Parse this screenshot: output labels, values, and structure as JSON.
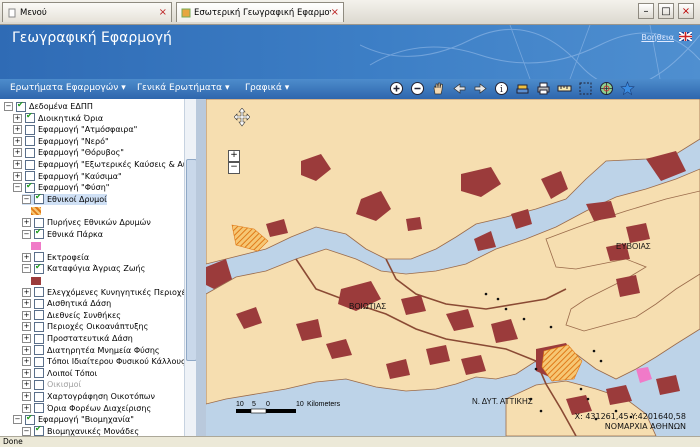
{
  "browser_tabs": [
    {
      "label": "Μενού",
      "active": false
    },
    {
      "label": "Εσωτερική Γεωγραφική Εφαρμογή",
      "active": true
    }
  ],
  "header": {
    "title": "Γεωγραφική Εφαρμογή",
    "help": "Βοήθεια"
  },
  "menus": [
    "Ερωτήματα Εφαρμογών",
    "Γενικά Ερωτήματα",
    "Γραφικά"
  ],
  "toolbar_icons": [
    "zoom-in-icon",
    "zoom-out-icon",
    "pan-hand-icon",
    "back-icon",
    "forward-icon",
    "identify-icon",
    "layers-icon",
    "print-icon",
    "measure-icon",
    "select-icon",
    "globe-icon",
    "star-icon"
  ],
  "layers": [
    {
      "label": "Δεδομένα ΕΔΠΠ",
      "checked": true,
      "indent": 0,
      "expander": "−"
    },
    {
      "label": "Διοικητικά Όρια",
      "checked": true,
      "indent": 1,
      "expander": "+"
    },
    {
      "label": "Εφαρμογή \"Ατμόσφαιρα\"",
      "checked": false,
      "indent": 1,
      "expander": "+"
    },
    {
      "label": "Εφαρμογή \"Νερό\"",
      "checked": false,
      "indent": 1,
      "expander": "+"
    },
    {
      "label": "Εφαρμογή \"Θόρυβος\"",
      "checked": false,
      "indent": 1,
      "expander": "+"
    },
    {
      "label": "Εφαρμογή \"Εξωτερικές Καύσεις & Αυτοκ",
      "checked": false,
      "indent": 1,
      "expander": "+"
    },
    {
      "label": "Εφαρμογή \"Καύσιμα\"",
      "checked": false,
      "indent": 1,
      "expander": "+"
    },
    {
      "label": "Εφαρμογή \"Φύση\"",
      "checked": true,
      "indent": 1,
      "expander": "−"
    },
    {
      "label": "Εθνικοί Δρυμοί",
      "checked": true,
      "indent": 2,
      "expander": "−",
      "selected": true
    },
    {
      "swatch": "orange-hatch",
      "indent": 3
    },
    {
      "label": "Πυρήνες Εθνικών Δρυμών",
      "checked": false,
      "indent": 2,
      "expander": "+"
    },
    {
      "label": "Εθνικά Πάρκα",
      "checked": true,
      "indent": 2,
      "expander": "−"
    },
    {
      "swatch": "pink",
      "indent": 3
    },
    {
      "label": "Εκτροφεία",
      "checked": false,
      "indent": 2,
      "expander": "+"
    },
    {
      "label": "Καταφύγια Άγριας Ζωής",
      "checked": true,
      "indent": 2,
      "expander": "−"
    },
    {
      "swatch": "brown",
      "indent": 3
    },
    {
      "label": "Ελεγχόμενες Κυνηγητικές Περιοχές",
      "checked": false,
      "indent": 2,
      "expander": "+"
    },
    {
      "label": "Αισθητικά Δάση",
      "checked": false,
      "indent": 2,
      "expander": "+"
    },
    {
      "label": "Διεθνείς Συνθήκες",
      "checked": false,
      "indent": 2,
      "expander": "+"
    },
    {
      "label": "Περιοχές Οικοανάπτυξης",
      "checked": false,
      "indent": 2,
      "expander": "+"
    },
    {
      "label": "Προστατευτικά Δάση",
      "checked": false,
      "indent": 2,
      "expander": "+"
    },
    {
      "label": "Διατηρητέα Μνημεία Φύσης",
      "checked": false,
      "indent": 2,
      "expander": "+"
    },
    {
      "label": "Τόποι Ιδιαίτερου Φυσικού Κάλλους",
      "checked": false,
      "indent": 2,
      "expander": "+"
    },
    {
      "label": "Λοιποί Τόποι",
      "checked": false,
      "indent": 2,
      "expander": "+"
    },
    {
      "label": "Οικισμοί",
      "checked": false,
      "indent": 2,
      "expander": "+",
      "greyed": true
    },
    {
      "label": "Χαρτογράφηση Οικοτόπων",
      "checked": false,
      "indent": 2,
      "expander": "+"
    },
    {
      "label": "Όρια Φορέων Διαχείρισης",
      "checked": false,
      "indent": 2,
      "expander": "+"
    },
    {
      "label": "Εφαρμογή \"Βιομηχανία\"",
      "checked": true,
      "indent": 1,
      "expander": "−"
    },
    {
      "label": "Βιομηχανικές Μονάδες",
      "checked": true,
      "indent": 2,
      "expander": "−"
    }
  ],
  "map": {
    "labels": [
      "ΕΥΒΟΙΑΣ",
      "ΒΟΙΩΤΙΑΣ",
      "Ν. ΔΥΤ. ΑΤΤΙΚΗΣ"
    ],
    "scale": {
      "ticks": [
        "10",
        "5",
        "0",
        "10"
      ],
      "unit": "Kilometers"
    },
    "coords": "X: 431261,45 Y:4201640,58",
    "prefecture": "ΝΟΜΑΡΧΙΑ ΑΘΗΝΩΝ"
  },
  "colors": {
    "land": "#f6deb0",
    "sea": "#bdd3e8",
    "boundary": "#8a4a34",
    "refuge": "#9b3b3b",
    "park_hatch": "#f39a2c"
  },
  "status": "Done"
}
